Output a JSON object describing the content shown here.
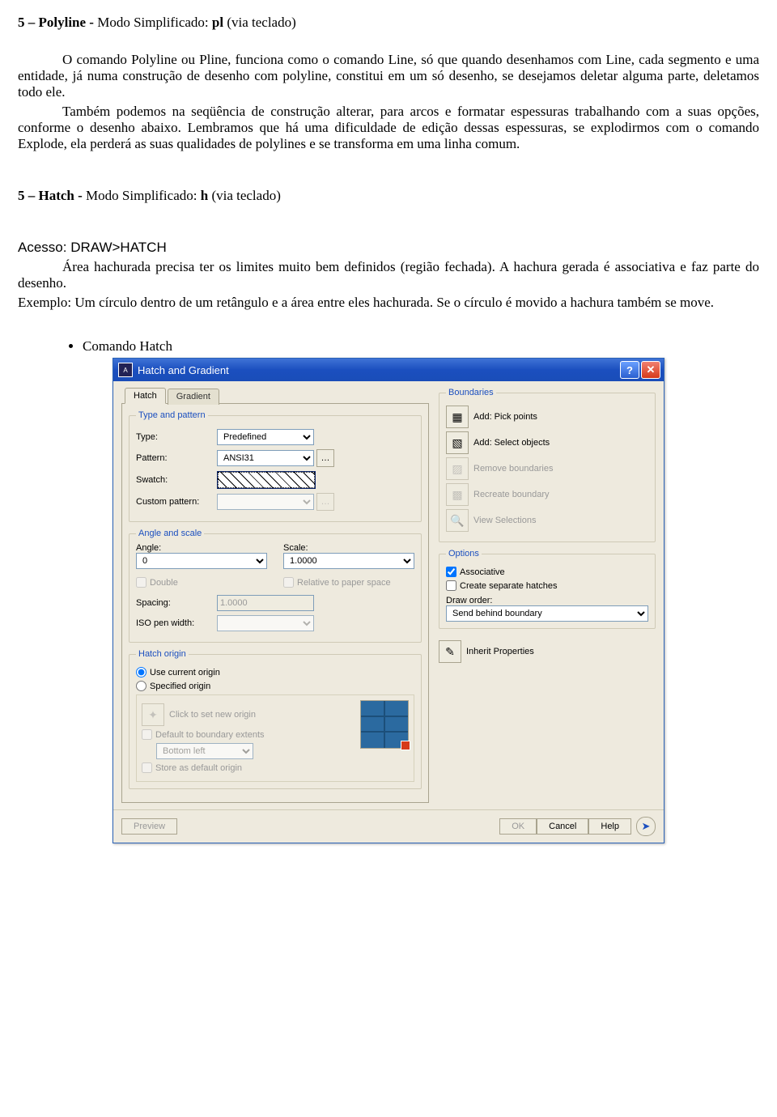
{
  "doc": {
    "section5_title_prefix": "5 – Polyline - ",
    "section5_title_mode": "Modo Simplificado: ",
    "section5_shortcut_prefix": "pl",
    "section5_shortcut_suffix": " (via teclado)",
    "para1": "O comando Polyline ou Pline, funciona como o comando Line, só que quando desenhamos com Line, cada segmento e uma entidade, já numa construção de desenho com polyline, constitui em um só desenho, se desejamos deletar alguma parte, deletamos todo ele.",
    "para2": "Também podemos na seqüência de construção alterar, para arcos e formatar espessuras trabalhando com a suas opções, conforme o desenho abaixo. Lembramos que há uma dificuldade de edição dessas espessuras, se explodirmos com o comando Explode, ela perderá as suas qualidades de polylines e se transforma em uma linha comum.",
    "section_hatch_prefix": "5 – Hatch - ",
    "section_hatch_mode": "Modo Simplificado: ",
    "section_hatch_shortcut_prefix": "h",
    "section_hatch_shortcut_suffix": " (via teclado)",
    "access_label": "Acesso: DRAW>HATCH",
    "para3": "Área hachurada precisa ter os limites muito bem definidos (região fechada). A hachura gerada é associativa e faz parte do desenho.",
    "para4": "Exemplo: Um círculo dentro de um retângulo e a área entre eles hachurada. Se o círculo é movido a hachura também se move.",
    "bullet1": "Comando Hatch"
  },
  "dialog": {
    "title": "Hatch and Gradient",
    "tabs": {
      "hatch": "Hatch",
      "gradient": "Gradient"
    },
    "groups": {
      "type_pattern": "Type and pattern",
      "angle_scale": "Angle and scale",
      "hatch_origin": "Hatch origin",
      "boundaries": "Boundaries",
      "options": "Options"
    },
    "labels": {
      "type": "Type:",
      "pattern": "Pattern:",
      "swatch": "Swatch:",
      "custom_pattern": "Custom pattern:",
      "angle": "Angle:",
      "scale": "Scale:",
      "double": "Double",
      "relative": "Relative to paper space",
      "spacing": "Spacing:",
      "iso_pen": "ISO pen width:",
      "use_current_origin": "Use current origin",
      "specified_origin": "Specified origin",
      "click_new_origin": "Click to set new origin",
      "default_extents": "Default to boundary extents",
      "bottom_left": "Bottom left",
      "store_default": "Store as default origin",
      "add_pick": "Add: Pick points",
      "add_select": "Add: Select objects",
      "remove_boundaries": "Remove boundaries",
      "recreate_boundary": "Recreate boundary",
      "view_selections": "View Selections",
      "associative": "Associative",
      "separate": "Create separate hatches",
      "draw_order": "Draw order:",
      "inherit": "Inherit Properties"
    },
    "values": {
      "type": "Predefined",
      "pattern": "ANSI31",
      "angle": "0",
      "scale": "1.0000",
      "spacing": "1.0000",
      "draw_order": "Send behind boundary"
    },
    "footer": {
      "preview": "Preview",
      "ok": "OK",
      "cancel": "Cancel",
      "help": "Help"
    }
  }
}
